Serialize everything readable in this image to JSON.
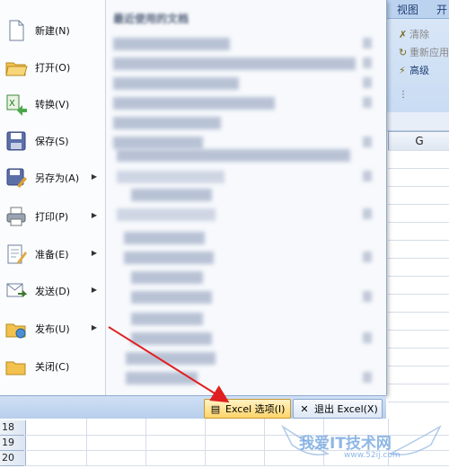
{
  "ribbon": {
    "tabs": [
      "视图",
      "开"
    ],
    "commands": [
      {
        "label": "清除",
        "enabled": false
      },
      {
        "label": "重新应用",
        "enabled": false
      },
      {
        "label": "高级",
        "enabled": true
      }
    ],
    "column_header": "G"
  },
  "menu": {
    "items": [
      {
        "label": "新建(N)",
        "icon": "new-document-icon",
        "submenu": false
      },
      {
        "label": "打开(O)",
        "icon": "open-folder-icon",
        "submenu": false
      },
      {
        "label": "转换(V)",
        "icon": "convert-icon",
        "submenu": false
      },
      {
        "label": "保存(S)",
        "icon": "save-disk-icon",
        "submenu": false
      },
      {
        "label": "另存为(A)",
        "icon": "save-as-icon",
        "submenu": true
      },
      {
        "label": "打印(P)",
        "icon": "printer-icon",
        "submenu": true
      },
      {
        "label": "准备(E)",
        "icon": "prepare-icon",
        "submenu": true
      },
      {
        "label": "发送(D)",
        "icon": "send-icon",
        "submenu": true
      },
      {
        "label": "发布(U)",
        "icon": "publish-icon",
        "submenu": true
      },
      {
        "label": "关闭(C)",
        "icon": "close-folder-icon",
        "submenu": false
      }
    ],
    "recent_title": "最近使用的文档",
    "options_button": "Excel 选项(I)",
    "exit_button": "退出 Excel(X)"
  },
  "sheet": {
    "rows": [
      "18",
      "19",
      "20"
    ]
  },
  "watermark": {
    "text": "我爱IT技术网",
    "url": "www.52ij.com"
  }
}
